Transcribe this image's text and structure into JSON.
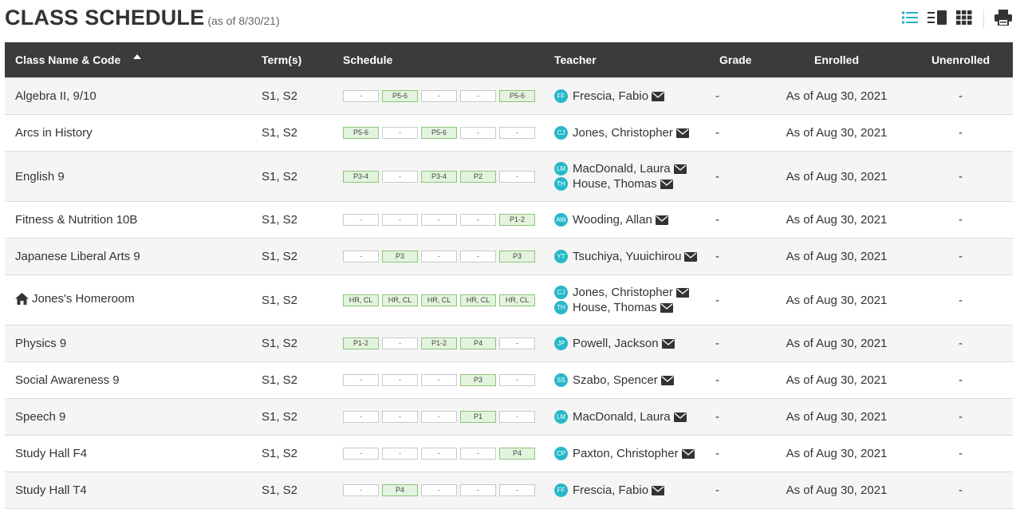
{
  "header": {
    "title": "CLASS SCHEDULE",
    "as_of": "(as of 8/30/21)"
  },
  "toolbar": {
    "icons": [
      "list-view-icon",
      "detail-view-icon",
      "grid-view-icon",
      "print-icon"
    ],
    "active_color": "#2ab0c5"
  },
  "columns": {
    "name": "Class Name & Code",
    "terms": "Term(s)",
    "schedule": "Schedule",
    "teacher": "Teacher",
    "grade": "Grade",
    "enrolled": "Enrolled",
    "unenrolled": "Unenrolled"
  },
  "rows": [
    {
      "name": "Algebra II, 9/10",
      "terms": "S1, S2",
      "blocks": [
        "-",
        "P5-6",
        "-",
        "-",
        "P5-6"
      ],
      "teachers": [
        {
          "initials": "FF",
          "name": "Frescia, Fabio"
        }
      ],
      "grade": "-",
      "enrolled": "As of Aug 30, 2021",
      "unenrolled": "-"
    },
    {
      "name": "Arcs in History",
      "terms": "S1, S2",
      "blocks": [
        "P5-6",
        "-",
        "P5-6",
        "-",
        "-"
      ],
      "teachers": [
        {
          "initials": "CJ",
          "name": "Jones, Christopher"
        }
      ],
      "grade": "-",
      "enrolled": "As of Aug 30, 2021",
      "unenrolled": "-"
    },
    {
      "name": "English 9",
      "terms": "S1, S2",
      "blocks": [
        "P3-4",
        "-",
        "P3-4",
        "P2",
        "-"
      ],
      "teachers": [
        {
          "initials": "LM",
          "name": "MacDonald, Laura"
        },
        {
          "initials": "TH",
          "name": "House, Thomas"
        }
      ],
      "grade": "-",
      "enrolled": "As of Aug 30, 2021",
      "unenrolled": "-"
    },
    {
      "name": "Fitness & Nutrition 10B",
      "terms": "S1, S2",
      "blocks": [
        "-",
        "-",
        "-",
        "-",
        "P1-2"
      ],
      "teachers": [
        {
          "initials": "AW",
          "name": "Wooding, Allan"
        }
      ],
      "grade": "-",
      "enrolled": "As of Aug 30, 2021",
      "unenrolled": "-"
    },
    {
      "name": "Japanese Liberal Arts 9",
      "terms": "S1, S2",
      "blocks": [
        "-",
        "P3",
        "-",
        "-",
        "P3"
      ],
      "teachers": [
        {
          "initials": "YT",
          "name": "Tsuchiya, Yuuichirou"
        }
      ],
      "grade": "-",
      "enrolled": "As of Aug 30, 2021",
      "unenrolled": "-"
    },
    {
      "name": "Jones's Homeroom",
      "terms": "S1, S2",
      "homeroom": true,
      "blocks": [
        "HR, CL",
        "HR, CL",
        "HR, CL",
        "HR, CL",
        "HR, CL"
      ],
      "teachers": [
        {
          "initials": "CJ",
          "name": "Jones, Christopher"
        },
        {
          "initials": "TH",
          "name": "House, Thomas"
        }
      ],
      "grade": "-",
      "enrolled": "As of Aug 30, 2021",
      "unenrolled": "-"
    },
    {
      "name": "Physics 9",
      "terms": "S1, S2",
      "blocks": [
        "P1-2",
        "-",
        "P1-2",
        "P4",
        "-"
      ],
      "teachers": [
        {
          "initials": "JP",
          "name": "Powell, Jackson"
        }
      ],
      "grade": "-",
      "enrolled": "As of Aug 30, 2021",
      "unenrolled": "-"
    },
    {
      "name": "Social Awareness 9",
      "terms": "S1, S2",
      "blocks": [
        "-",
        "-",
        "-",
        "P3",
        "-"
      ],
      "teachers": [
        {
          "initials": "SS",
          "name": "Szabo, Spencer"
        }
      ],
      "grade": "-",
      "enrolled": "As of Aug 30, 2021",
      "unenrolled": "-"
    },
    {
      "name": "Speech 9",
      "terms": "S1, S2",
      "blocks": [
        "-",
        "-",
        "-",
        "P1",
        "-"
      ],
      "teachers": [
        {
          "initials": "LM",
          "name": "MacDonald, Laura"
        }
      ],
      "grade": "-",
      "enrolled": "As of Aug 30, 2021",
      "unenrolled": "-"
    },
    {
      "name": "Study Hall F4",
      "terms": "S1, S2",
      "blocks": [
        "-",
        "-",
        "-",
        "-",
        "P4"
      ],
      "teachers": [
        {
          "initials": "CP",
          "name": "Paxton, Christopher"
        }
      ],
      "grade": "-",
      "enrolled": "As of Aug 30, 2021",
      "unenrolled": "-"
    },
    {
      "name": "Study Hall T4",
      "terms": "S1, S2",
      "blocks": [
        "-",
        "P4",
        "-",
        "-",
        "-"
      ],
      "teachers": [
        {
          "initials": "FF",
          "name": "Frescia, Fabio"
        }
      ],
      "grade": "-",
      "enrolled": "As of Aug 30, 2021",
      "unenrolled": "-"
    }
  ]
}
